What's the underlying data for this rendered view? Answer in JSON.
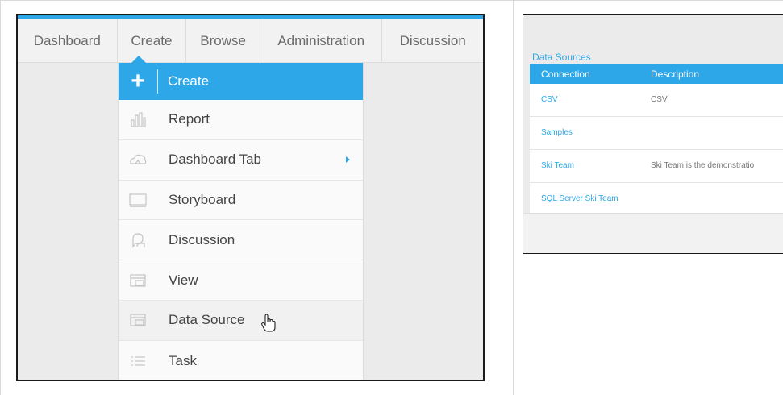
{
  "nav": {
    "items": [
      {
        "label": "Dashboard"
      },
      {
        "label": "Create"
      },
      {
        "label": "Browse"
      },
      {
        "label": "Administration"
      },
      {
        "label": "Discussion"
      }
    ]
  },
  "menu": {
    "header_label": "Create",
    "items": [
      {
        "label": "Report",
        "icon": "bar-chart-icon"
      },
      {
        "label": "Dashboard Tab",
        "icon": "cloud-icon",
        "submenu": true
      },
      {
        "label": "Storyboard",
        "icon": "monitor-icon"
      },
      {
        "label": "Discussion",
        "icon": "chat-bubble-icon"
      },
      {
        "label": "View",
        "icon": "view-table-icon"
      },
      {
        "label": "Data Source",
        "icon": "data-source-icon",
        "hovered": true
      },
      {
        "label": "Task",
        "icon": "list-icon"
      }
    ]
  },
  "datasources": {
    "title": "Data Sources",
    "columns": [
      "Connection",
      "Description"
    ],
    "rows": [
      {
        "connection": "CSV",
        "description": "CSV"
      },
      {
        "connection": "Samples",
        "description": ""
      },
      {
        "connection": "Ski Team",
        "description": "Ski Team is the demonstratio"
      },
      {
        "connection": "SQL Server Ski Team",
        "description": ""
      }
    ]
  },
  "colors": {
    "accent": "#2ea7e8",
    "nav_bg": "#f2f2f2",
    "text": "#444444"
  }
}
